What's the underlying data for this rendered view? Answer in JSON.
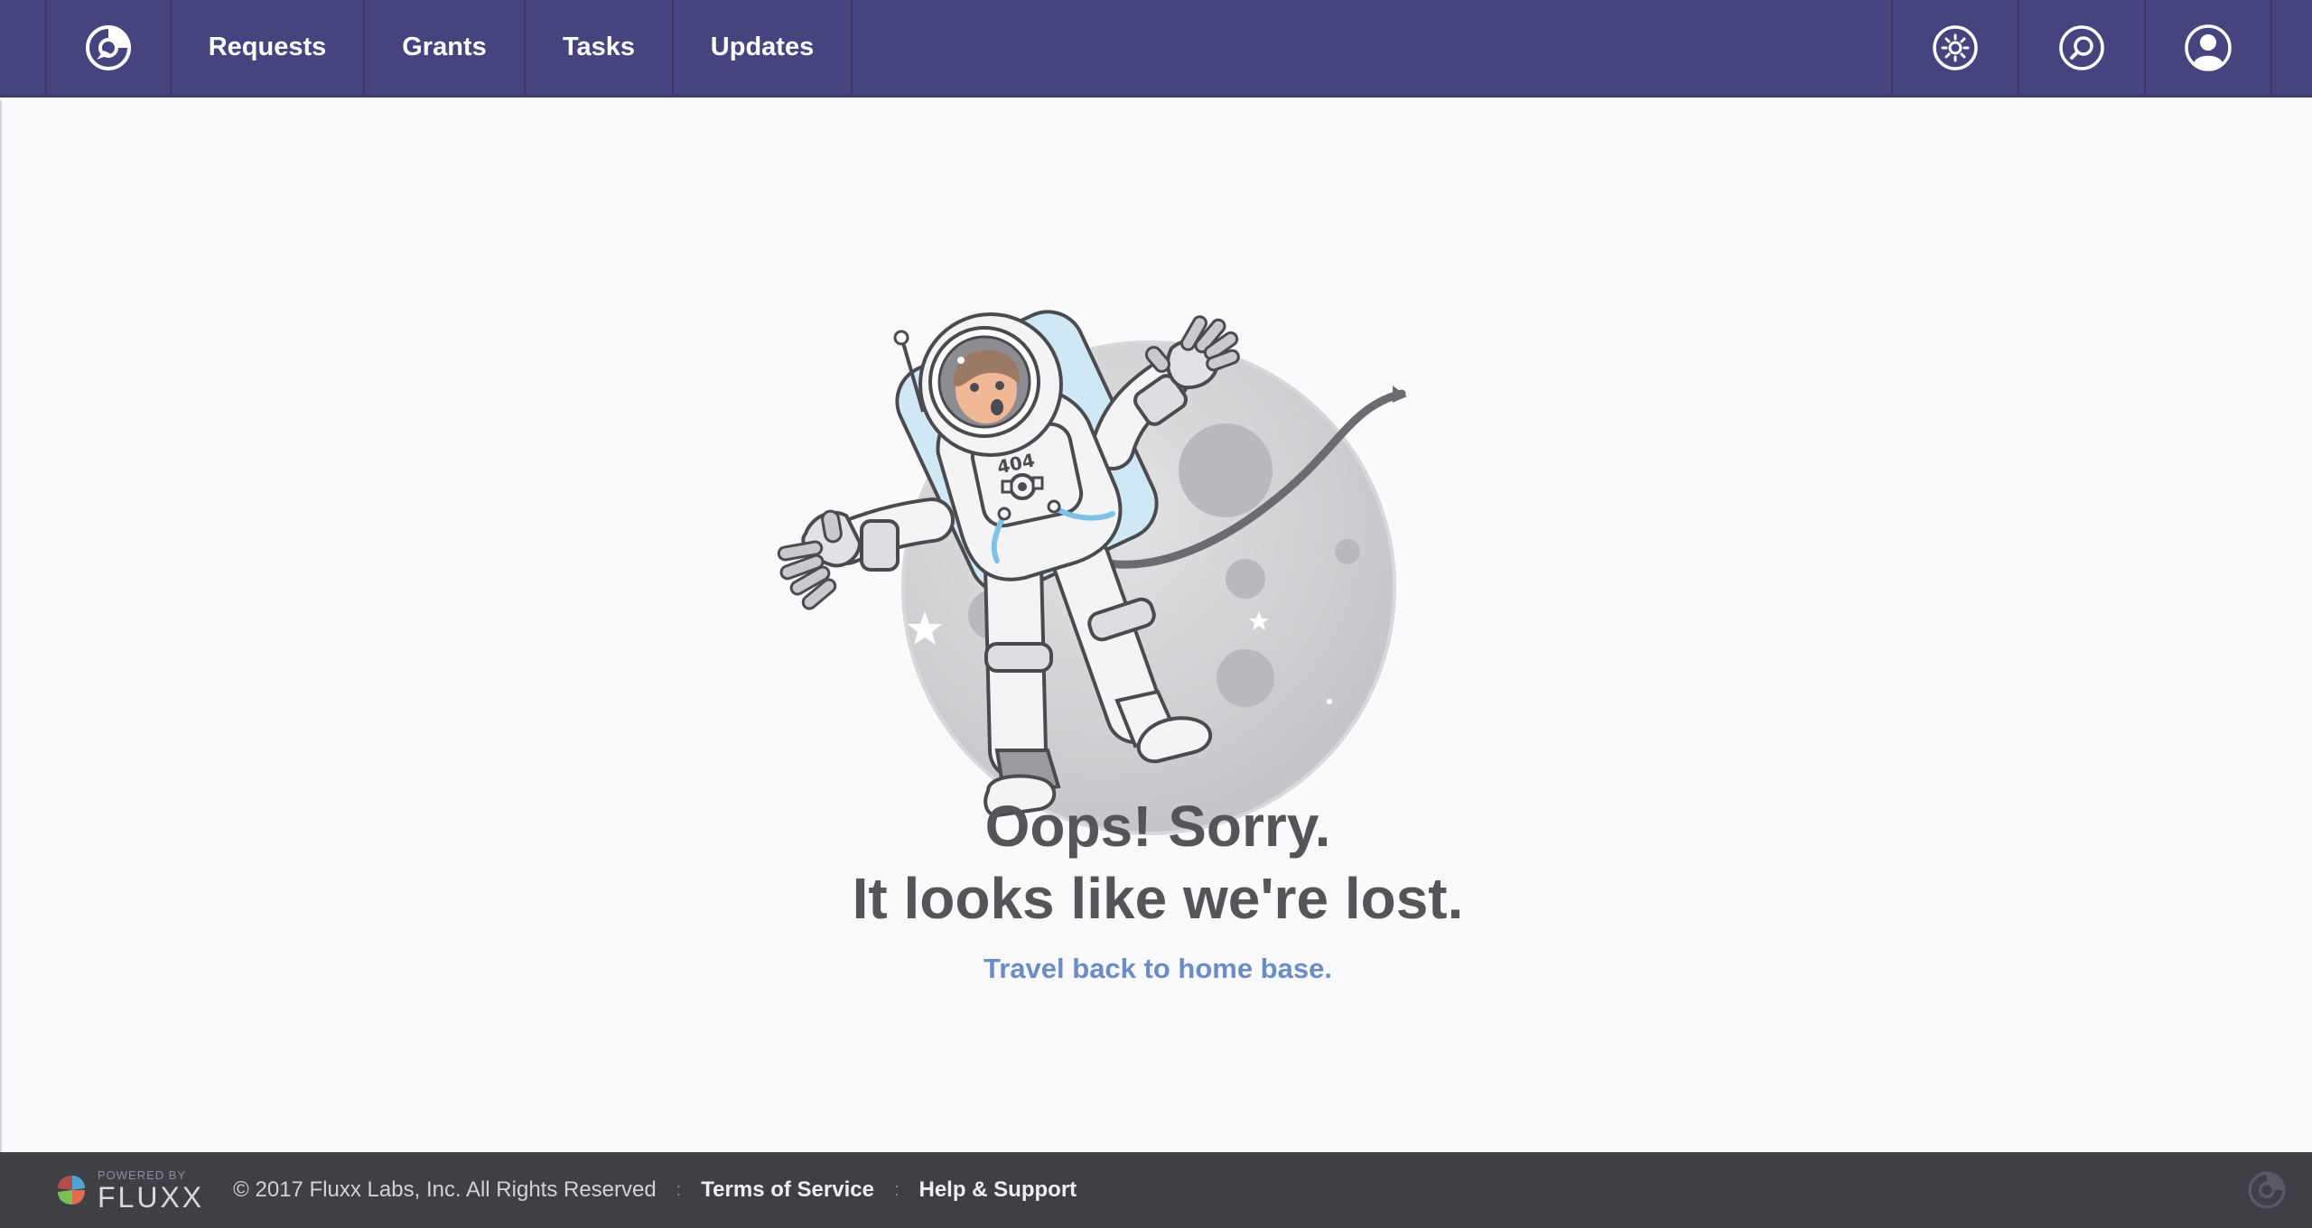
{
  "nav": {
    "logo_icon": "fluxx-compass-icon",
    "items": [
      {
        "label": "Requests"
      },
      {
        "label": "Grants"
      },
      {
        "label": "Tasks"
      },
      {
        "label": "Updates"
      }
    ],
    "right_icons": [
      "settings-icon",
      "search-icon",
      "user-profile-icon"
    ],
    "background": "#46447f"
  },
  "error": {
    "badge": "404",
    "line1": "Oops! Sorry.",
    "line2": "It looks like we're lost.",
    "link_label": "Travel back to home base."
  },
  "footer": {
    "powered_by": "POWERED BY",
    "brand": "FLUXX",
    "copyright": "© 2017 Fluxx Labs, Inc. All Rights Reserved",
    "separator": ":",
    "terms_label": "Terms of Service",
    "help_label": "Help & Support"
  },
  "colors": {
    "accent_link": "#6b8cc4",
    "heading": "#555559",
    "footer_bg": "#3f4045"
  }
}
